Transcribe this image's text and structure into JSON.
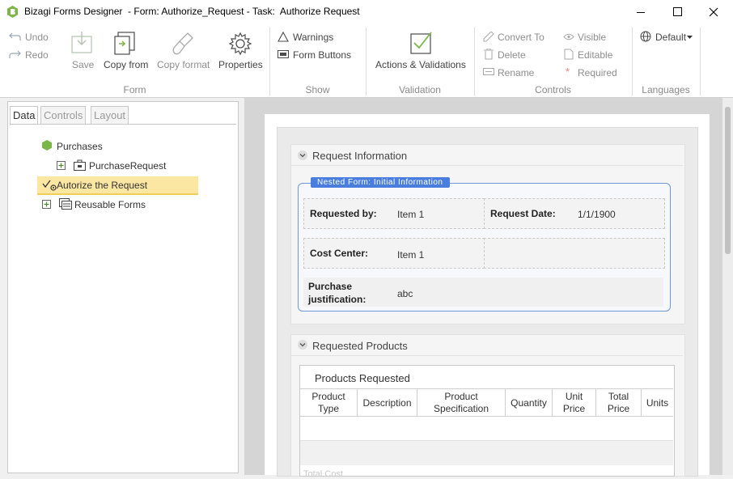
{
  "window": {
    "title": "Bizagi Forms Designer  - Form: Authorize_Request - Task:  Authorize Request"
  },
  "ribbon": {
    "undo": "Undo",
    "redo": "Redo",
    "save": "Save",
    "copy_from": "Copy from",
    "copy_format": "Copy format",
    "properties": "Properties",
    "group_form": "Form",
    "warnings": "Warnings",
    "form_buttons": "Form Buttons",
    "group_show": "Show",
    "actions_validations": "Actions & Validations",
    "group_validation": "Validation",
    "convert_to": "Convert To",
    "delete": "Delete",
    "rename": "Rename",
    "visible": "Visible",
    "editable": "Editable",
    "required": "Required",
    "group_controls": "Controls",
    "language": "Default",
    "group_languages": "Languages"
  },
  "left_panel": {
    "tabs": [
      "Data",
      "Controls",
      "Layout"
    ],
    "tree": {
      "root": "Purchases",
      "child": "PurchaseRequest",
      "selected": "Autorize the Request",
      "reusable": "Reusable Forms"
    }
  },
  "form": {
    "section1": "Request Information",
    "nested_badge": "Nested Form: Initial Information",
    "requested_by_label": "Requested by:",
    "requested_by_value": "Item 1",
    "request_date_label": "Request Date:",
    "request_date_value": "1/1/1900",
    "cost_center_label": "Cost Center:",
    "cost_center_value": "Item 1",
    "justification_label_1": "Purchase",
    "justification_label_2": "justification:",
    "justification_value": "abc",
    "section2": "Requested Products",
    "grid_title": "Products Requested",
    "grid_columns": [
      [
        "Product",
        "Type"
      ],
      [
        "Description",
        ""
      ],
      [
        "Product",
        "Specification"
      ],
      [
        "Quantity",
        ""
      ],
      [
        "Unit",
        "Price"
      ],
      [
        "Total",
        "Price"
      ],
      [
        "Units",
        ""
      ]
    ],
    "partial_label": "Total Cost"
  },
  "colors": {
    "accent": "#4a7ede",
    "selection": "#fbe6a2",
    "icon_green": "#7ab648"
  }
}
